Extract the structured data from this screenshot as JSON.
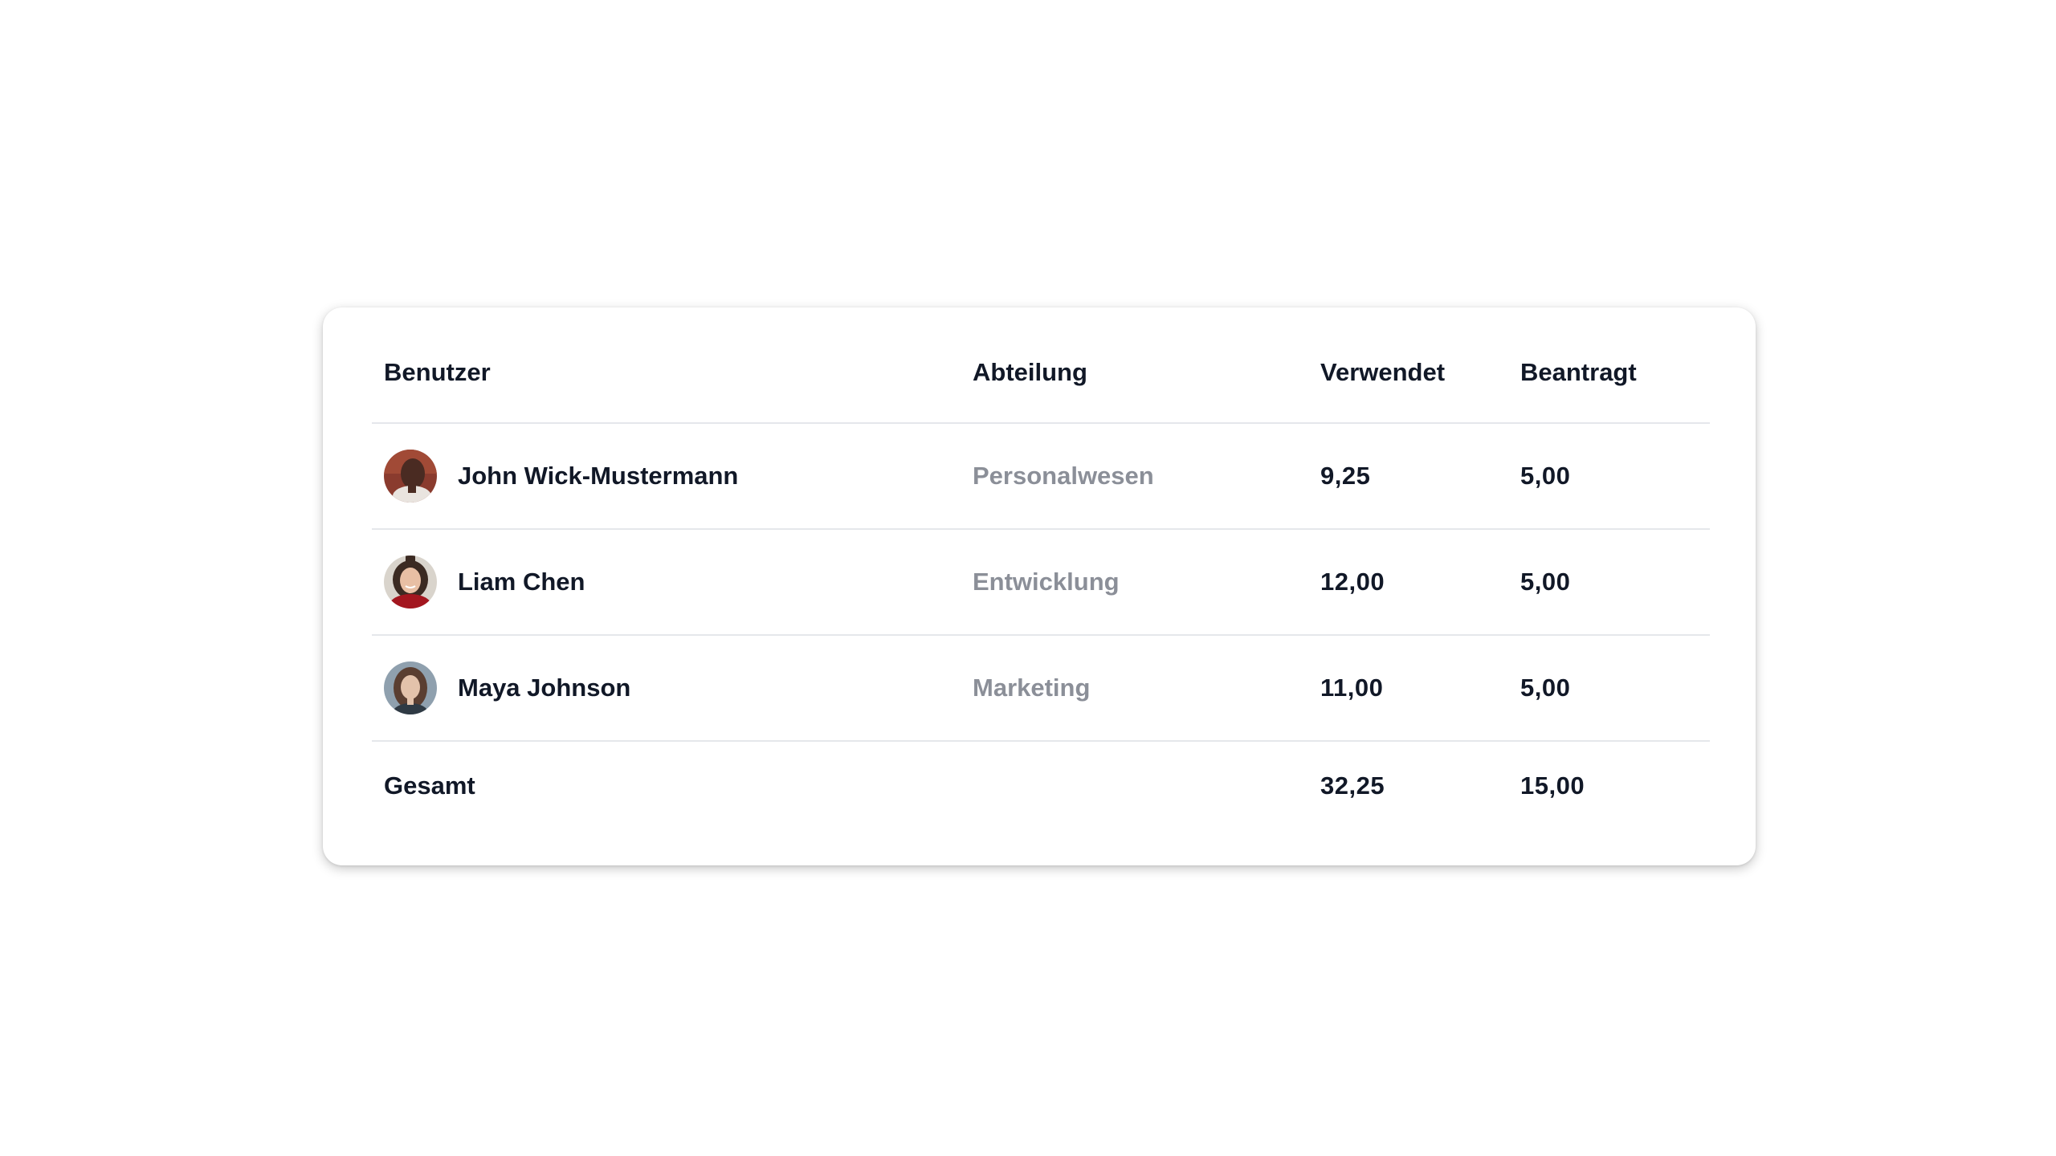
{
  "table": {
    "headers": {
      "user": "Benutzer",
      "department": "Abteilung",
      "used": "Verwendet",
      "requested": "Beantragt"
    },
    "rows": [
      {
        "name": "John Wick-Mustermann",
        "department": "Personalwesen",
        "used": "9,25",
        "requested": "5,00",
        "avatar_icon": "avatar-photo"
      },
      {
        "name": "Liam Chen",
        "department": "Entwicklung",
        "used": "12,00",
        "requested": "5,00",
        "avatar_icon": "avatar-photo"
      },
      {
        "name": "Maya Johnson",
        "department": "Marketing",
        "used": "11,00",
        "requested": "5,00",
        "avatar_icon": "avatar-photo"
      }
    ],
    "total": {
      "label": "Gesamt",
      "used": "32,25",
      "requested": "15,00"
    }
  },
  "colors": {
    "text": "#111827",
    "muted": "#8b8f98",
    "divider": "#e5e7eb"
  }
}
